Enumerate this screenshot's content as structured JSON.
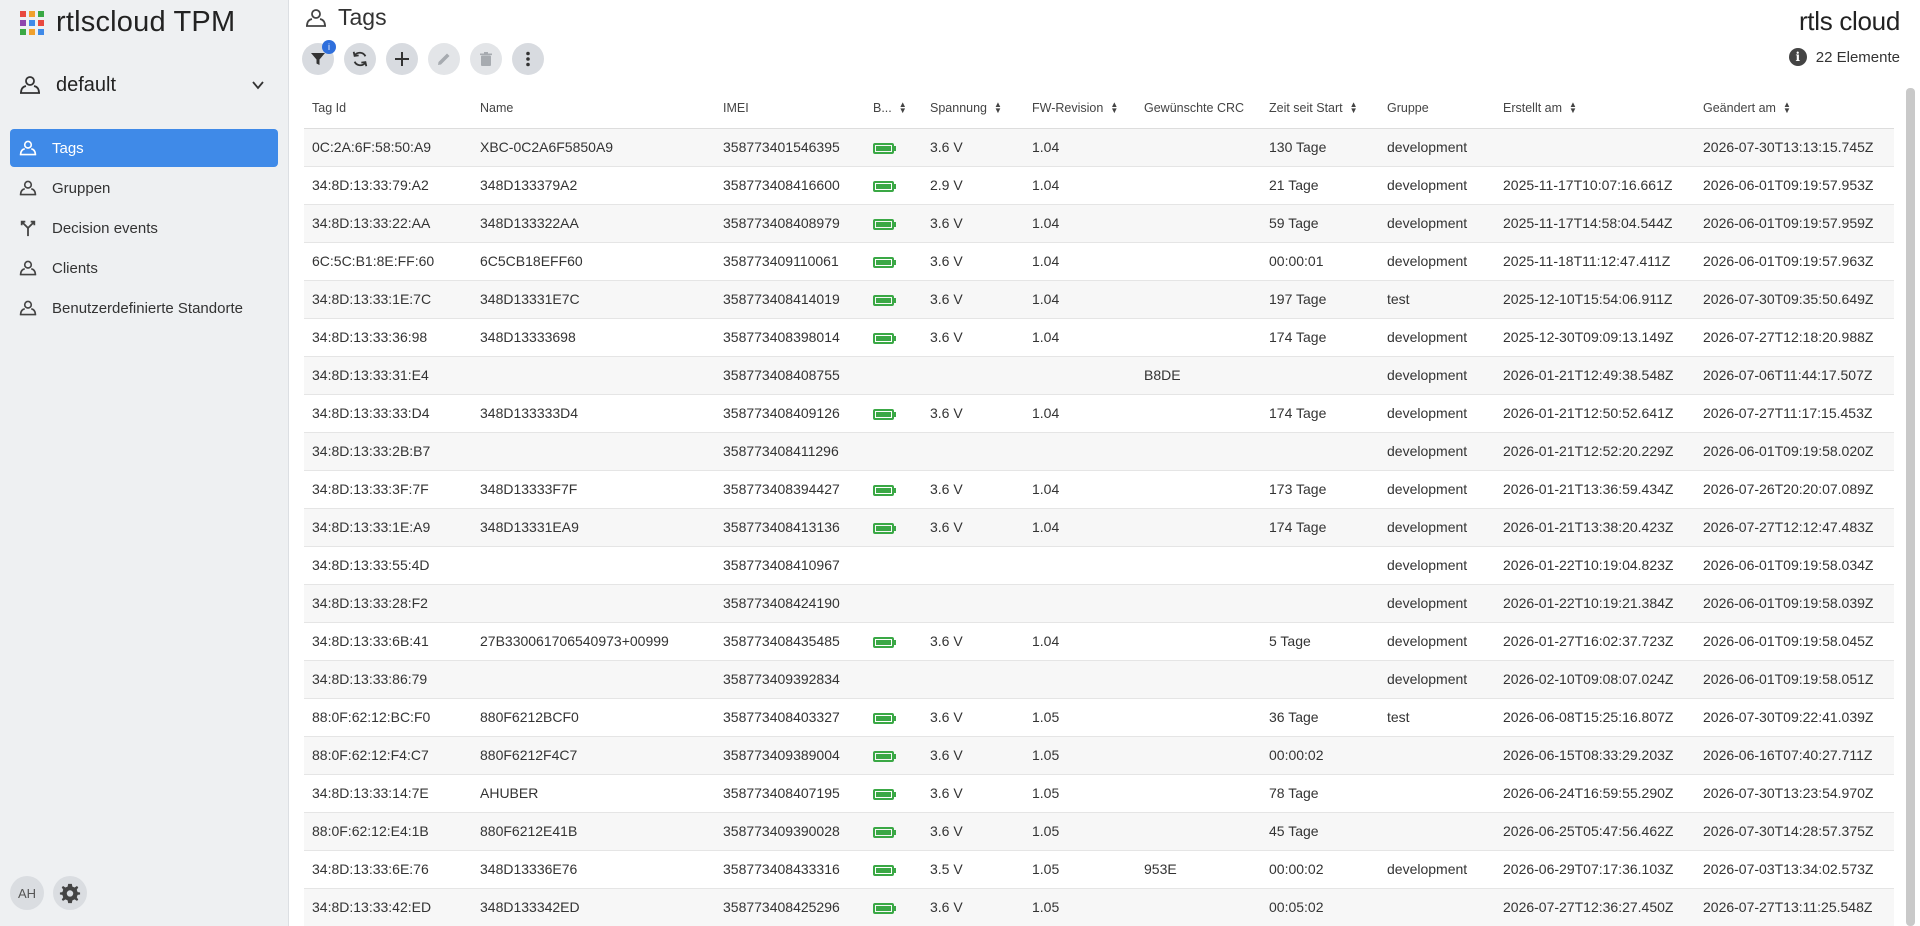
{
  "app": {
    "title": "rtlscloud TPM",
    "logo_text": "rtls cloud"
  },
  "tenant": {
    "label": "default"
  },
  "sidebar": {
    "items": [
      {
        "label": "Tags",
        "icon": "tag-icon",
        "active": true
      },
      {
        "label": "Gruppen",
        "icon": "group-icon",
        "active": false
      },
      {
        "label": "Decision events",
        "icon": "decision-icon",
        "active": false
      },
      {
        "label": "Clients",
        "icon": "clients-icon",
        "active": false
      },
      {
        "label": "Benutzerdefinierte Standorte",
        "icon": "location-icon",
        "active": false
      }
    ],
    "avatar": "AH"
  },
  "page": {
    "title": "Tags",
    "count": "22 Elemente",
    "filter_badge": "i"
  },
  "colors": {
    "accent": "#3f8ae8",
    "battery": "#3aa845",
    "badge": "#2f6fdc"
  },
  "table": {
    "columns": [
      {
        "label": "Tag Id",
        "sortable": false
      },
      {
        "label": "Name",
        "sortable": false
      },
      {
        "label": "IMEI",
        "sortable": false
      },
      {
        "label": "B...",
        "sortable": true
      },
      {
        "label": "Spannung",
        "sortable": true
      },
      {
        "label": "FW-Revision",
        "sortable": true
      },
      {
        "label": "Gewünschte CRC",
        "sortable": false
      },
      {
        "label": "Zeit seit Start",
        "sortable": true
      },
      {
        "label": "Gruppe",
        "sortable": false
      },
      {
        "label": "Erstellt am",
        "sortable": true
      },
      {
        "label": "Geändert am",
        "sortable": true
      }
    ],
    "rows": [
      {
        "id": "0C:2A:6F:58:50:A9",
        "name": "XBC-0C2A6F5850A9",
        "imei": "358773401546395",
        "battery": true,
        "voltage": "3.6 V",
        "fw": "1.04",
        "crc": "",
        "uptime": "130 Tage",
        "group": "development",
        "created": "",
        "modified": "2026-07-30T13:13:15.745Z"
      },
      {
        "id": "34:8D:13:33:79:A2",
        "name": "348D133379A2",
        "imei": "358773408416600",
        "battery": true,
        "voltage": "2.9 V",
        "fw": "1.04",
        "crc": "",
        "uptime": "21 Tage",
        "group": "development",
        "created": "2025-11-17T10:07:16.661Z",
        "modified": "2026-06-01T09:19:57.953Z"
      },
      {
        "id": "34:8D:13:33:22:AA",
        "name": "348D133322AA",
        "imei": "358773408408979",
        "battery": true,
        "voltage": "3.6 V",
        "fw": "1.04",
        "crc": "",
        "uptime": "59 Tage",
        "group": "development",
        "created": "2025-11-17T14:58:04.544Z",
        "modified": "2026-06-01T09:19:57.959Z"
      },
      {
        "id": "6C:5C:B1:8E:FF:60",
        "name": "6C5CB18EFF60",
        "imei": "358773409110061",
        "battery": true,
        "voltage": "3.6 V",
        "fw": "1.04",
        "crc": "",
        "uptime": "00:00:01",
        "group": "development",
        "created": "2025-11-18T11:12:47.411Z",
        "modified": "2026-06-01T09:19:57.963Z"
      },
      {
        "id": "34:8D:13:33:1E:7C",
        "name": "348D13331E7C",
        "imei": "358773408414019",
        "battery": true,
        "voltage": "3.6 V",
        "fw": "1.04",
        "crc": "",
        "uptime": "197 Tage",
        "group": "test",
        "created": "2025-12-10T15:54:06.911Z",
        "modified": "2026-07-30T09:35:50.649Z"
      },
      {
        "id": "34:8D:13:33:36:98",
        "name": "348D13333698",
        "imei": "358773408398014",
        "battery": true,
        "voltage": "3.6 V",
        "fw": "1.04",
        "crc": "",
        "uptime": "174 Tage",
        "group": "development",
        "created": "2025-12-30T09:09:13.149Z",
        "modified": "2026-07-27T12:18:20.988Z"
      },
      {
        "id": "34:8D:13:33:31:E4",
        "name": "",
        "imei": "358773408408755",
        "battery": false,
        "voltage": "",
        "fw": "",
        "crc": "B8DE",
        "uptime": "",
        "group": "development",
        "created": "2026-01-21T12:49:38.548Z",
        "modified": "2026-07-06T11:44:17.507Z"
      },
      {
        "id": "34:8D:13:33:33:D4",
        "name": "348D133333D4",
        "imei": "358773408409126",
        "battery": true,
        "voltage": "3.6 V",
        "fw": "1.04",
        "crc": "",
        "uptime": "174 Tage",
        "group": "development",
        "created": "2026-01-21T12:50:52.641Z",
        "modified": "2026-07-27T11:17:15.453Z"
      },
      {
        "id": "34:8D:13:33:2B:B7",
        "name": "",
        "imei": "358773408411296",
        "battery": false,
        "voltage": "",
        "fw": "",
        "crc": "",
        "uptime": "",
        "group": "development",
        "created": "2026-01-21T12:52:20.229Z",
        "modified": "2026-06-01T09:19:58.020Z"
      },
      {
        "id": "34:8D:13:33:3F:7F",
        "name": "348D13333F7F",
        "imei": "358773408394427",
        "battery": true,
        "voltage": "3.6 V",
        "fw": "1.04",
        "crc": "",
        "uptime": "173 Tage",
        "group": "development",
        "created": "2026-01-21T13:36:59.434Z",
        "modified": "2026-07-26T20:20:07.089Z"
      },
      {
        "id": "34:8D:13:33:1E:A9",
        "name": "348D13331EA9",
        "imei": "358773408413136",
        "battery": true,
        "voltage": "3.6 V",
        "fw": "1.04",
        "crc": "",
        "uptime": "174 Tage",
        "group": "development",
        "created": "2026-01-21T13:38:20.423Z",
        "modified": "2026-07-27T12:12:47.483Z"
      },
      {
        "id": "34:8D:13:33:55:4D",
        "name": "",
        "imei": "358773408410967",
        "battery": false,
        "voltage": "",
        "fw": "",
        "crc": "",
        "uptime": "",
        "group": "development",
        "created": "2026-01-22T10:19:04.823Z",
        "modified": "2026-06-01T09:19:58.034Z"
      },
      {
        "id": "34:8D:13:33:28:F2",
        "name": "",
        "imei": "358773408424190",
        "battery": false,
        "voltage": "",
        "fw": "",
        "crc": "",
        "uptime": "",
        "group": "development",
        "created": "2026-01-22T10:19:21.384Z",
        "modified": "2026-06-01T09:19:58.039Z"
      },
      {
        "id": "34:8D:13:33:6B:41",
        "name": "27B330061706540973+00999",
        "imei": "358773408435485",
        "battery": true,
        "voltage": "3.6 V",
        "fw": "1.04",
        "crc": "",
        "uptime": "5 Tage",
        "group": "development",
        "created": "2026-01-27T16:02:37.723Z",
        "modified": "2026-06-01T09:19:58.045Z"
      },
      {
        "id": "34:8D:13:33:86:79",
        "name": "",
        "imei": "358773409392834",
        "battery": false,
        "voltage": "",
        "fw": "",
        "crc": "",
        "uptime": "",
        "group": "development",
        "created": "2026-02-10T09:08:07.024Z",
        "modified": "2026-06-01T09:19:58.051Z"
      },
      {
        "id": "88:0F:62:12:BC:F0",
        "name": "880F6212BCF0",
        "imei": "358773408403327",
        "battery": true,
        "voltage": "3.6 V",
        "fw": "1.05",
        "crc": "",
        "uptime": "36 Tage",
        "group": "test",
        "created": "2026-06-08T15:25:16.807Z",
        "modified": "2026-07-30T09:22:41.039Z"
      },
      {
        "id": "88:0F:62:12:F4:C7",
        "name": "880F6212F4C7",
        "imei": "358773409389004",
        "battery": true,
        "voltage": "3.6 V",
        "fw": "1.05",
        "crc": "",
        "uptime": "00:00:02",
        "group": "",
        "created": "2026-06-15T08:33:29.203Z",
        "modified": "2026-06-16T07:40:27.711Z"
      },
      {
        "id": "34:8D:13:33:14:7E",
        "name": "AHUBER",
        "imei": "358773408407195",
        "battery": true,
        "voltage": "3.6 V",
        "fw": "1.05",
        "crc": "",
        "uptime": "78 Tage",
        "group": "",
        "created": "2026-06-24T16:59:55.290Z",
        "modified": "2026-07-30T13:23:54.970Z"
      },
      {
        "id": "88:0F:62:12:E4:1B",
        "name": "880F6212E41B",
        "imei": "358773409390028",
        "battery": true,
        "voltage": "3.6 V",
        "fw": "1.05",
        "crc": "",
        "uptime": "45 Tage",
        "group": "",
        "created": "2026-06-25T05:47:56.462Z",
        "modified": "2026-07-30T14:28:57.375Z"
      },
      {
        "id": "34:8D:13:33:6E:76",
        "name": "348D13336E76",
        "imei": "358773408433316",
        "battery": true,
        "voltage": "3.5 V",
        "fw": "1.05",
        "crc": "953E",
        "uptime": "00:00:02",
        "group": "development",
        "created": "2026-06-29T07:17:36.103Z",
        "modified": "2026-07-03T13:34:02.573Z"
      },
      {
        "id": "34:8D:13:33:42:ED",
        "name": "348D133342ED",
        "imei": "358773408425296",
        "battery": true,
        "voltage": "3.6 V",
        "fw": "1.05",
        "crc": "",
        "uptime": "00:05:02",
        "group": "",
        "created": "2026-07-27T12:36:27.450Z",
        "modified": "2026-07-27T13:11:25.548Z"
      }
    ]
  }
}
